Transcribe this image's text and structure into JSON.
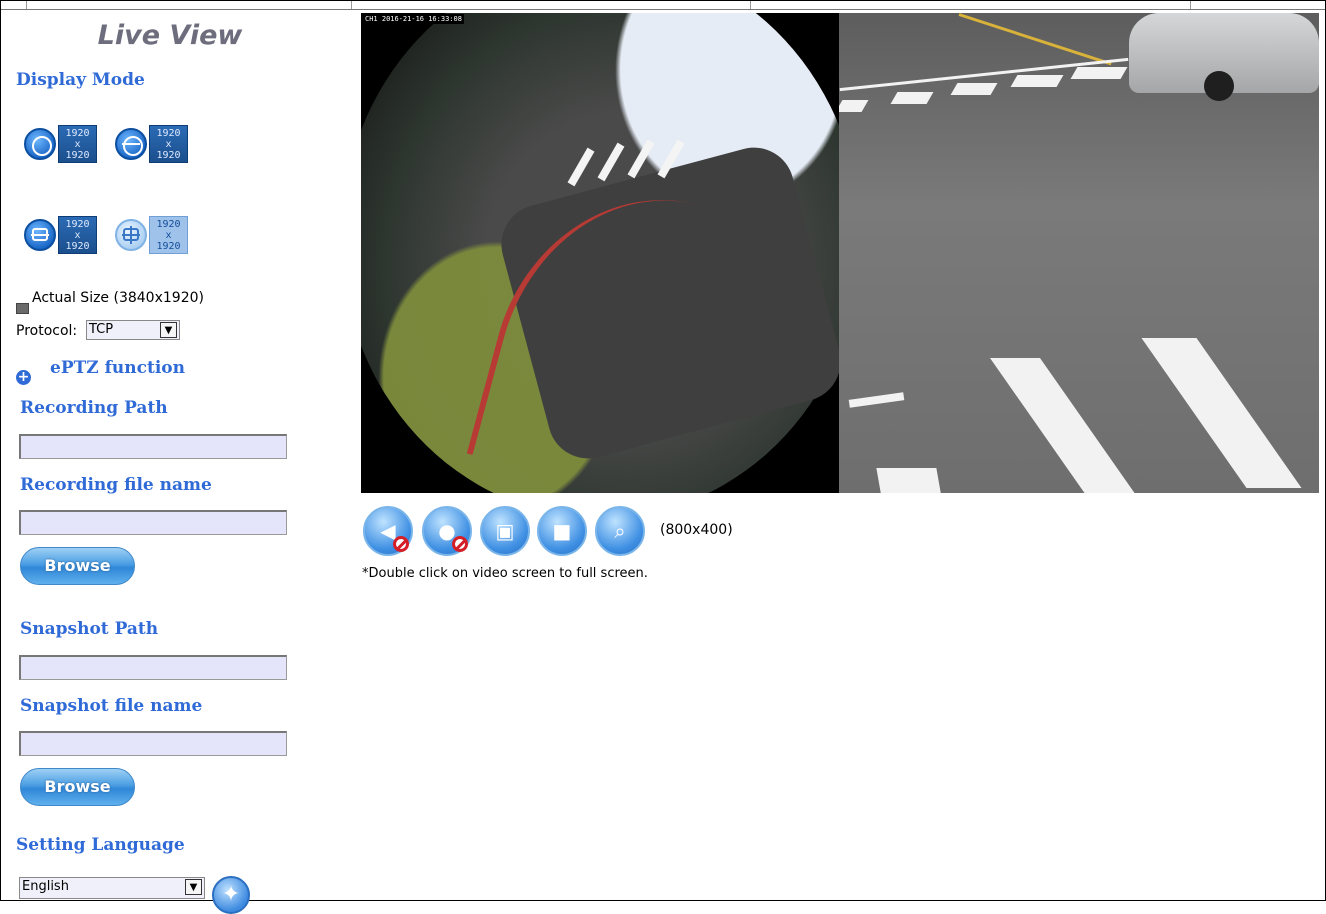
{
  "sidebar": {
    "title": "Live View",
    "display_mode_heading": "Display Mode",
    "display_modes": [
      {
        "icon": "fisheye-circle-icon",
        "res_line1": "1920",
        "res_line2": "x",
        "res_line3": "1920"
      },
      {
        "icon": "panorama-split-icon",
        "res_line1": "1920",
        "res_line2": "x",
        "res_line3": "1920"
      },
      {
        "icon": "panorama-quad-icon",
        "res_line1": "1920",
        "res_line2": "x",
        "res_line3": "1920"
      },
      {
        "icon": "grid-quad-icon",
        "res_line1": "1920",
        "res_line2": "x",
        "res_line3": "1920"
      }
    ],
    "actual_size_label": "Actual Size (3840x1920)",
    "protocol_label": "Protocol:",
    "protocol_value": "TCP",
    "eptz_label": "ePTZ function",
    "recording_path_heading": "Recording Path",
    "recording_path_value": "",
    "recording_file_heading": "Recording file name",
    "recording_file_value": "",
    "browse_label_1": "Browse",
    "snapshot_path_heading": "Snapshot Path",
    "snapshot_path_value": "",
    "snapshot_file_heading": "Snapshot file name",
    "snapshot_file_value": "",
    "browse_label_2": "Browse",
    "language_heading": "Setting Language",
    "language_value": "English"
  },
  "video": {
    "overlay_stamp": "CH1 2016-21-16 16:33:08",
    "controls": [
      {
        "name": "speaker-mute-icon"
      },
      {
        "name": "microphone-mute-icon"
      },
      {
        "name": "snapshot-camera-icon"
      },
      {
        "name": "record-video-icon"
      },
      {
        "name": "zoom-icon"
      }
    ],
    "resolution": "(800x400)",
    "hint": "*Double click on video screen to full screen."
  },
  "colors": {
    "heading_blue": "#2f6ad7",
    "title_gray": "#6d6d7d",
    "input_bg": "#e4e4fb"
  }
}
